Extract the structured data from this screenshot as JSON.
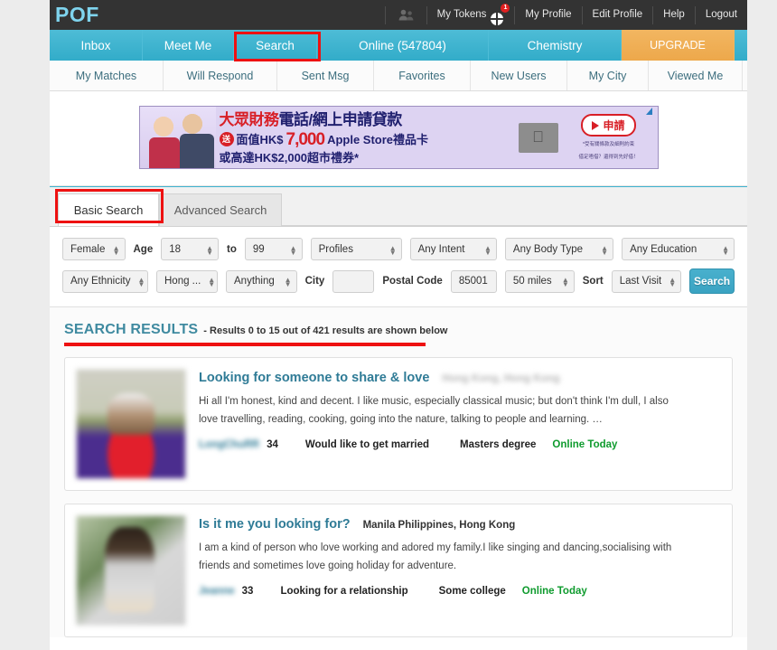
{
  "brand": {
    "logo": "POF"
  },
  "topbar": {
    "people_icon": "people-icon",
    "items": [
      {
        "label": "My Tokens",
        "icon": "token-globe-icon",
        "badge": "1"
      },
      {
        "label": "My Profile"
      },
      {
        "label": "Edit Profile"
      },
      {
        "label": "Help"
      },
      {
        "label": "Logout"
      }
    ]
  },
  "mainnav": {
    "tabs": [
      {
        "label": "Inbox"
      },
      {
        "label": "Meet Me"
      },
      {
        "label": "Search",
        "highlighted": true
      },
      {
        "label": "Online (547804)"
      },
      {
        "label": "Chemistry"
      },
      {
        "label": "UPGRADE"
      }
    ]
  },
  "subnav": {
    "tabs": [
      {
        "label": "My Matches"
      },
      {
        "label": "Will Respond"
      },
      {
        "label": "Sent Msg"
      },
      {
        "label": "Favorites"
      },
      {
        "label": "New Users"
      },
      {
        "label": "My City"
      },
      {
        "label": "Viewed Me"
      }
    ]
  },
  "ad": {
    "line1_a": "大眾財務",
    "line1_b": "電話/網上申請貸款",
    "seal": "送",
    "line2_a": "面值HK$",
    "line2_big": "7,000",
    "line2_b": "Apple Store禮品卡",
    "line3": "或高達HK$2,000超市禮券*",
    "apple_icon": "apple-logo-icon",
    "cta": "申請",
    "fine1": "*受有關條款及細則約束",
    "fine2": "借定唔借？還得到先好借！",
    "adchoices_icon": "adchoices-icon"
  },
  "search_tabs": {
    "basic": "Basic Search",
    "advanced": "Advanced Search",
    "active": "Basic Search"
  },
  "filters": {
    "row1": [
      {
        "name": "gender",
        "type": "select",
        "value": "Female"
      },
      {
        "name": "age-label",
        "type": "label",
        "value": "Age"
      },
      {
        "name": "age-min",
        "type": "select",
        "value": "18"
      },
      {
        "name": "to-label",
        "type": "label",
        "value": "to"
      },
      {
        "name": "age-max",
        "type": "select",
        "value": "99"
      },
      {
        "name": "profiles",
        "type": "select",
        "value": "Profiles"
      },
      {
        "name": "intent",
        "type": "select",
        "value": "Any Intent"
      },
      {
        "name": "body-type",
        "type": "select",
        "value": "Any Body Type"
      },
      {
        "name": "education",
        "type": "select",
        "value": "Any Education"
      }
    ],
    "row2": [
      {
        "name": "ethnicity",
        "type": "select",
        "value": "Any Ethnicity"
      },
      {
        "name": "region",
        "type": "select",
        "value": "Hong ..."
      },
      {
        "name": "anything",
        "type": "select",
        "value": "Anything"
      },
      {
        "name": "city-label",
        "type": "label",
        "value": "City"
      },
      {
        "name": "city",
        "type": "text",
        "value": ""
      },
      {
        "name": "postal-label",
        "type": "label",
        "value": "Postal Code"
      },
      {
        "name": "postal-code",
        "type": "text",
        "value": "85001"
      },
      {
        "name": "distance",
        "type": "select",
        "value": "50 miles"
      },
      {
        "name": "sort-label",
        "type": "label",
        "value": "Sort"
      },
      {
        "name": "sort",
        "type": "select",
        "value": "Last Visit"
      }
    ],
    "search_button": "Search"
  },
  "results": {
    "title": "SEARCH RESULTS",
    "subtitle": "- Results 0 to 15 out of 421 results are shown below",
    "cards": [
      {
        "headline": "Looking for someone to share & love",
        "location": "Hong Kong, Hong Kong",
        "location_blurred": true,
        "description": "Hi all I'm honest, kind and decent. I like music, especially classical music; but don't think I'm dull, I also love travelling, reading, cooking, going into the nature, talking to people and learning. …",
        "username": "LongChuRR",
        "username_blurred": true,
        "age": "34",
        "intent": "Would like to get married",
        "education": "Masters degree",
        "status": "Online Today"
      },
      {
        "headline": "Is it me you looking for?",
        "location": "Manila Philippines, Hong Kong",
        "location_blurred": false,
        "description": "I am a kind of person who love working and adored my family.I like singing and dancing,socialising with friends and sometimes love going holiday for adventure.",
        "username": "Jeanne",
        "username_blurred": true,
        "age": "33",
        "intent": "Looking for a relationship",
        "education": "Some college",
        "status": "Online Today"
      }
    ]
  },
  "colors": {
    "brand_blue": "#39b3d0",
    "logo_blue": "#7fd4ee",
    "upgrade_orange": "#eda84b",
    "header_dark": "#333333",
    "highlight_red": "#ee1111",
    "online_green": "#0f9b2e",
    "title_teal": "#2f7b96"
  }
}
